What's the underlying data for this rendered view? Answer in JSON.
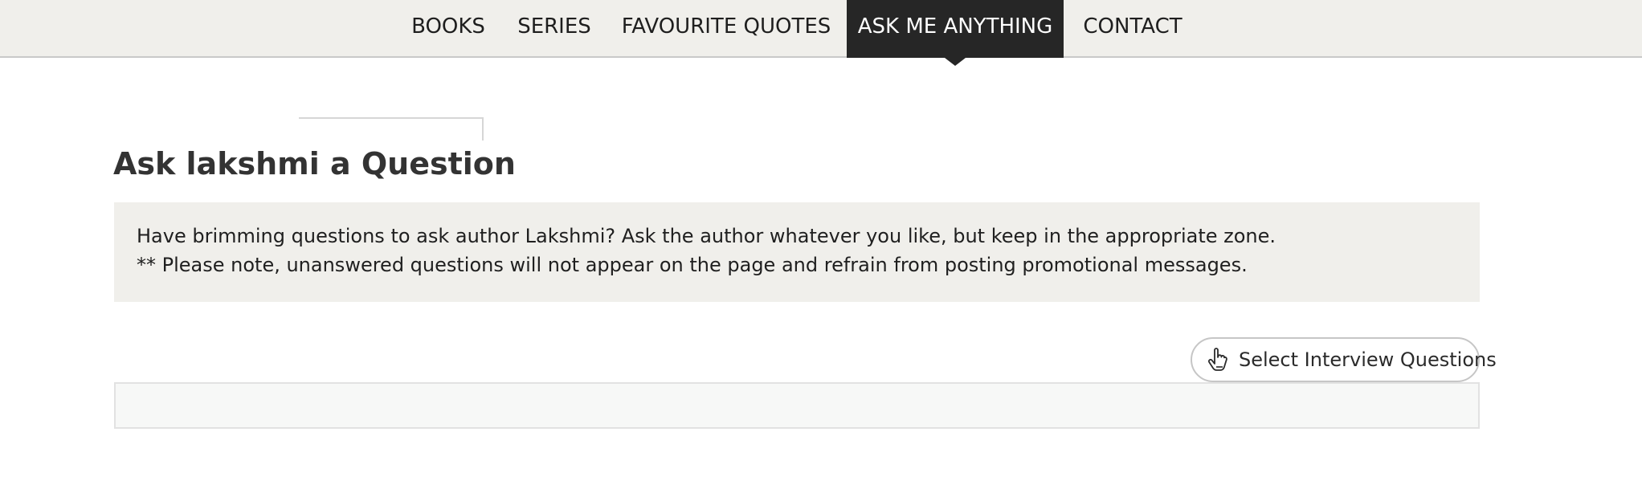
{
  "nav": {
    "items": [
      {
        "label": "BOOKS"
      },
      {
        "label": "SERIES"
      },
      {
        "label": "FAVOURITE QUOTES"
      },
      {
        "label": "ASK ME ANYTHING",
        "active": true
      },
      {
        "label": "CONTACT"
      }
    ]
  },
  "page": {
    "title": "Ask lakshmi a Question"
  },
  "notice": {
    "line1": "Have brimming questions to ask author Lakshmi? Ask the author whatever you like, but keep in the appropriate zone.",
    "line2": "** Please note, unanswered questions will not appear on the page and refrain from posting promotional messages."
  },
  "actions": {
    "select_questions_label": "Select Interview Questions",
    "select_questions_icon": "pointer-hand-icon"
  },
  "colors": {
    "nav_background": "#f0efeb",
    "nav_active_background": "#262626",
    "notice_background": "#f0efeb"
  }
}
